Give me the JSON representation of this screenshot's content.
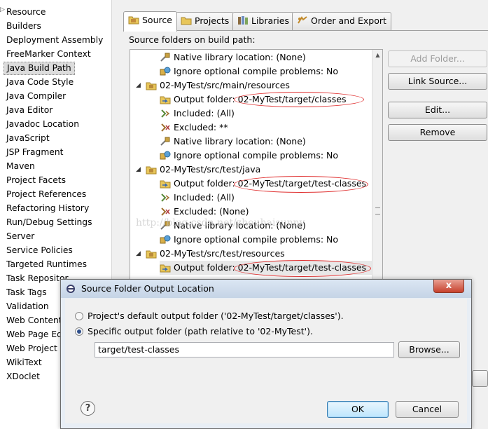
{
  "left_list": {
    "items": [
      "Resource",
      "Builders",
      "Deployment Assembly",
      "FreeMarker Context",
      "Java Build Path",
      "Java Code Style",
      "Java Compiler",
      "Java Editor",
      "Javadoc Location",
      "JavaScript",
      "JSP Fragment",
      "Maven",
      "Project Facets",
      "Project References",
      "Refactoring History",
      "Run/Debug Settings",
      "Server",
      "Service Policies",
      "Targeted Runtimes",
      "Task Repositor",
      "Task Tags",
      "Validation",
      "Web Content",
      "Web Page Ed",
      "Web Project S",
      "WikiText",
      "XDoclet"
    ],
    "selected": "Java Build Path"
  },
  "tabs": [
    {
      "label": "Source",
      "icon": "source-folder-icon",
      "active": true
    },
    {
      "label": "Projects",
      "icon": "project-icon",
      "active": false
    },
    {
      "label": "Libraries",
      "icon": "library-icon",
      "active": false
    },
    {
      "label": "Order and Export",
      "icon": "order-export-icon",
      "active": false
    }
  ],
  "source_label": "Source folders on build path:",
  "tree": {
    "rows": [
      {
        "text": "Native library location: (None)",
        "icon": "native-library-icon"
      },
      {
        "text": "Ignore optional compile problems: No",
        "icon": "ignore-problems-icon"
      },
      {
        "text": "02-MyTest/src/main/resources",
        "icon": "package-folder-icon"
      },
      {
        "text": "Output folder: 02-MyTest/target/classes",
        "icon": "output-folder-icon"
      },
      {
        "text": "Included: (All)",
        "icon": "included-icon"
      },
      {
        "text": "Excluded: **",
        "icon": "excluded-icon"
      },
      {
        "text": "Native library location: (None)",
        "icon": "native-library-icon"
      },
      {
        "text": "Ignore optional compile problems: No",
        "icon": "ignore-problems-icon"
      },
      {
        "text": "02-MyTest/src/test/java",
        "icon": "package-folder-icon"
      },
      {
        "text": "Output folder: 02-MyTest/target/test-classes",
        "icon": "output-folder-icon"
      },
      {
        "text": "Included: (All)",
        "icon": "included-icon"
      },
      {
        "text": "Excluded: (None)",
        "icon": "excluded-icon"
      },
      {
        "text": "Native library location: (None)",
        "icon": "native-library-icon"
      },
      {
        "text": "Ignore optional compile problems: No",
        "icon": "ignore-problems-icon"
      },
      {
        "text": "02-MyTest/src/test/resources",
        "icon": "package-folder-icon"
      },
      {
        "text": "Output folder: 02-MyTest/target/test-classes",
        "icon": "output-folder-icon",
        "selected": true
      }
    ]
  },
  "buttons": {
    "add_folder": "Add Folder...",
    "link_source": "Link Source...",
    "edit": "Edit...",
    "remove": "Remove"
  },
  "watermark": "http://blog.csdn.net/zhouhaisunny",
  "dialog": {
    "title": "Source Folder Output Location",
    "option_default": "Project's default output folder ('02-MyTest/target/classes').",
    "option_specific": "Specific output folder (path relative to '02-MyTest').",
    "path_value": "target/test-classes",
    "browse_label": "Browse...",
    "ok_label": "OK",
    "cancel_label": "Cancel",
    "close_glyph": "x",
    "help_glyph": "?"
  },
  "colors": {
    "annotation": "#e03030",
    "selection": "#dcdcdc",
    "dialog_frame": "#e8eef5"
  }
}
